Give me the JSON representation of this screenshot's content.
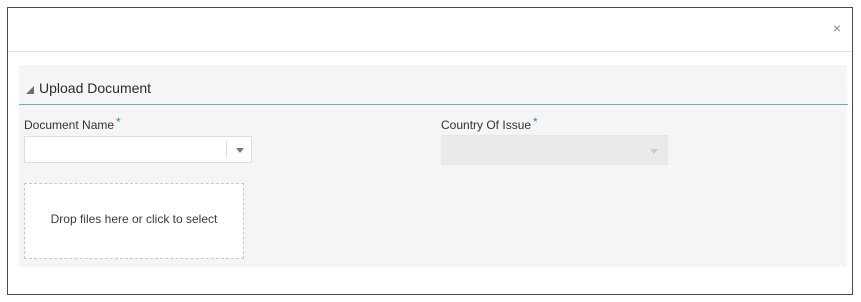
{
  "dialog": {
    "close_glyph": "×"
  },
  "section": {
    "title": "Upload Document"
  },
  "fields": {
    "document_name": {
      "label": "Document Name",
      "required_marker": "*",
      "value": ""
    },
    "country_of_issue": {
      "label": "Country Of Issue",
      "required_marker": "*",
      "value": "",
      "disabled": true
    }
  },
  "dropzone": {
    "text": "Drop files here or click to select"
  },
  "icons": {
    "close": "close-icon",
    "collapse": "collapse-triangle-icon",
    "dropdown": "chevron-down-icon"
  },
  "colors": {
    "accent": "#2c8fb8",
    "section_rule": "#5fb3bf",
    "panel_bg": "#f5f5f5"
  }
}
